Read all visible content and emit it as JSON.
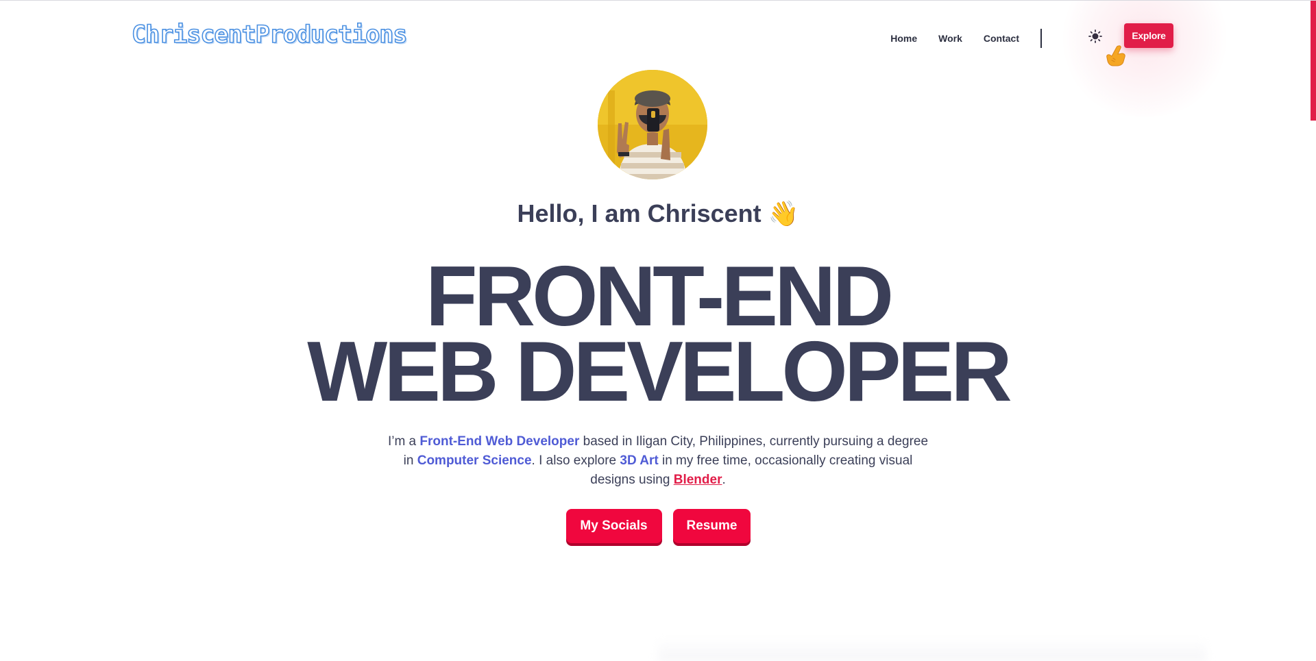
{
  "header": {
    "logo_text": "ChriscentProductions",
    "nav_items": [
      {
        "label": "Home"
      },
      {
        "label": "Work"
      },
      {
        "label": "Contact"
      }
    ],
    "theme_toggle_icon": "sun-icon",
    "explore_label": "Explore",
    "cursor_icon": "pointing-hand-icon"
  },
  "hero": {
    "avatar_icon": "profile-photo",
    "greeting": "Hello, I am Chriscent 👋",
    "title_line_1": "FRONT-END",
    "title_line_2": "WEB DEVELOPER",
    "description": {
      "part_1": "I’m a ",
      "highlight_1": "Front-End Web Developer",
      "part_2": " based in Iligan City, Philippines, currently pursuing a degree in ",
      "highlight_2": "Computer Science",
      "part_3": ". I also explore ",
      "highlight_3": "3D Art",
      "part_4": " in my free time, occasionally creating visual designs using ",
      "link_1": "Blender",
      "part_5": "."
    },
    "buttons": {
      "socials_label": "My Socials",
      "resume_label": "Resume"
    }
  },
  "colors": {
    "accent": "#e11d48",
    "button": "#f0073e",
    "highlight": "#4f5bd5",
    "text": "#3b3f58",
    "logo_stroke": "#4a90e2"
  }
}
